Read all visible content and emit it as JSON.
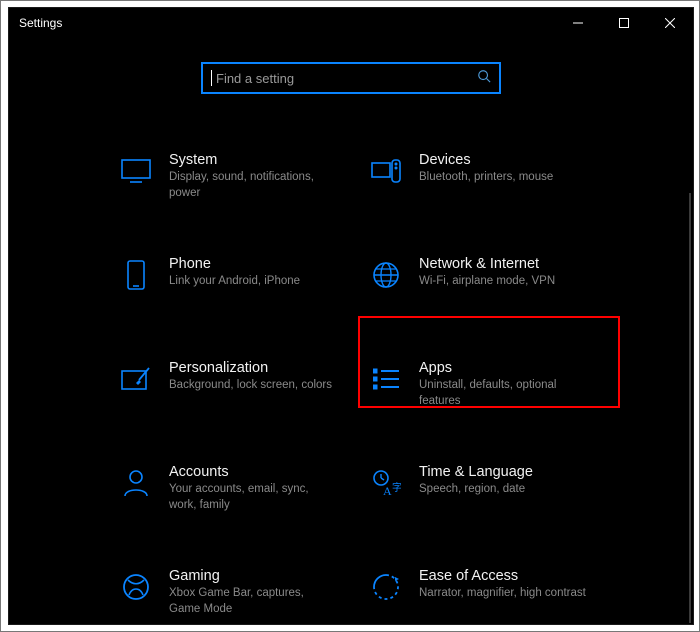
{
  "window": {
    "title": "Settings"
  },
  "search": {
    "placeholder": "Find a setting"
  },
  "tiles": [
    {
      "key": "system",
      "title": "System",
      "desc": "Display, sound, notifications, power"
    },
    {
      "key": "devices",
      "title": "Devices",
      "desc": "Bluetooth, printers, mouse"
    },
    {
      "key": "phone",
      "title": "Phone",
      "desc": "Link your Android, iPhone"
    },
    {
      "key": "network",
      "title": "Network & Internet",
      "desc": "Wi-Fi, airplane mode, VPN"
    },
    {
      "key": "personalization",
      "title": "Personalization",
      "desc": "Background, lock screen, colors"
    },
    {
      "key": "apps",
      "title": "Apps",
      "desc": "Uninstall, defaults, optional features"
    },
    {
      "key": "accounts",
      "title": "Accounts",
      "desc": "Your accounts, email, sync, work, family"
    },
    {
      "key": "time",
      "title": "Time & Language",
      "desc": "Speech, region, date"
    },
    {
      "key": "gaming",
      "title": "Gaming",
      "desc": "Xbox Game Bar, captures, Game Mode"
    },
    {
      "key": "ease",
      "title": "Ease of Access",
      "desc": "Narrator, magnifier, high contrast"
    }
  ],
  "colors": {
    "accent": "#0a84ff",
    "highlight": "#ff0000",
    "text_muted": "#8a8a8a"
  },
  "highlighted_tile": "apps"
}
